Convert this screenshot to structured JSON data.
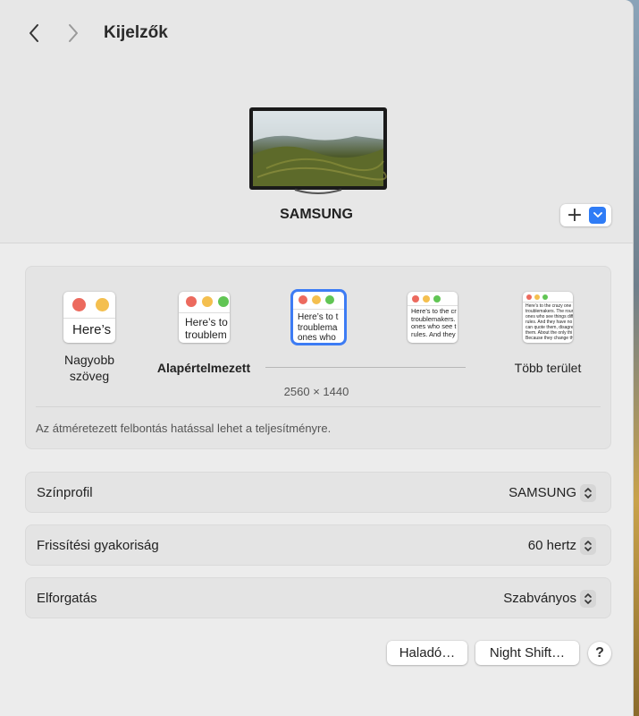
{
  "header": {
    "title": "Kijelzők",
    "back_icon": "chevron-left-icon",
    "forward_icon": "chevron-right-icon"
  },
  "display": {
    "name": "SAMSUNG",
    "add_label": "+"
  },
  "resolution": {
    "options": [
      {
        "label": "Nagyobb\nszöveg",
        "preview_text": "Here’s"
      },
      {
        "label": "Alapértelmezett",
        "preview_text": "Here’s to\ntroublem"
      },
      {
        "label": "",
        "preview_text": "Here’s to t\ntroublema\nones who"
      },
      {
        "label": "",
        "preview_text": "Here’s to the cr\ntroublemakers.\nones who see t\nrules. And they"
      },
      {
        "label": "Több terület",
        "preview_text": "Here’s to the crazy one\ntroublemakers. The roun\nones who see things diff\nrules. And they have no\ncan quote them, disagre\nthem. About the only thi\nBecause they change th"
      }
    ],
    "selected_index": 2,
    "current_value": "2560 × 1440",
    "note": "Az átméretezett felbontás hatással lehet a teljesítményre."
  },
  "settings": [
    {
      "label": "Színprofil",
      "value": "SAMSUNG"
    },
    {
      "label": "Frissítési gyakoriság",
      "value": "60 hertz"
    },
    {
      "label": "Elforgatás",
      "value": "Szabványos"
    }
  ],
  "buttons": {
    "advanced": "Haladó…",
    "night_shift": "Night Shift…",
    "help": "?"
  },
  "colors": {
    "accent": "#2f7cf6",
    "traffic_red": "#ec6a5e",
    "traffic_yellow": "#f4bf4f",
    "traffic_green": "#61c554"
  }
}
